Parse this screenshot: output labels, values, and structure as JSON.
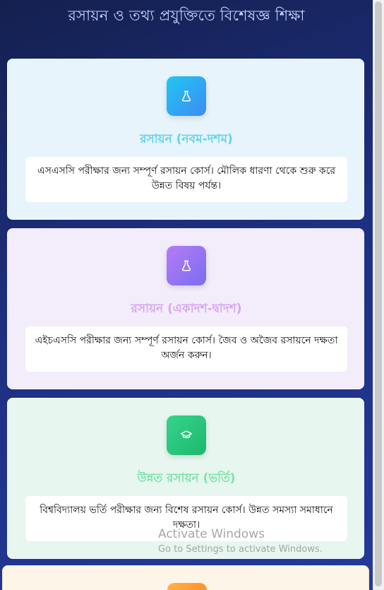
{
  "page_heading": "রসায়ন ও তথ্য প্রযুক্তিতে বিশেষজ্ঞ শিক্ষা",
  "courses": [
    {
      "icon": "flask-icon",
      "title": "রসায়ন (নবম-দশম)",
      "description": "এসএসসি পরীক্ষার জন্য সম্পূর্ণ রসায়ন কোর্স। মৌলিক ধারণা থেকে শুরু করে উন্নত বিষয় পর্যন্ত।",
      "accent": "#21c7f0"
    },
    {
      "icon": "flask-icon",
      "title": "রসায়ন (একাদশ-দ্বাদশ)",
      "description": "এইচএসসি পরীক্ষার জন্য সম্পূর্ণ রসায়ন কোর্স। জৈব ও অজৈব রসায়নে দক্ষতা অর্জন করুন।",
      "accent": "#b57cf5"
    },
    {
      "icon": "graduation-cap-icon",
      "title": "উন্নত রসায়ন (ভর্তি)",
      "description": "বিশ্ববিদ্যালয় ভর্তি পরীক্ষার জন্য বিশেষ রসায়ন কোর্স। উন্নত সমস্যা সমাধানে দক্ষতা।",
      "accent": "#36d38c"
    }
  ],
  "windows_watermark": {
    "title": "Activate Windows",
    "subtitle": "Go to Settings to activate Windows."
  }
}
